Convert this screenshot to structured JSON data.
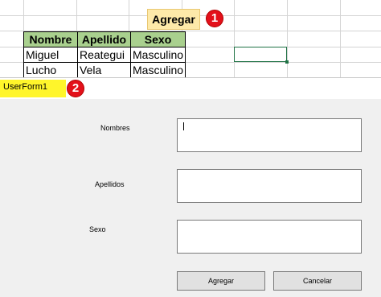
{
  "excel": {
    "headers": [
      "Nombre",
      "Apellido",
      "Sexo"
    ],
    "rows": [
      [
        "Miguel",
        "Reategui",
        "Masculino"
      ],
      [
        "Lucho",
        "Vela",
        "Masculino"
      ]
    ],
    "agregar_button": "Agregar",
    "header_fill": "#a9d08e"
  },
  "badges": {
    "one": "1",
    "two": "2"
  },
  "form": {
    "title": "UserForm1",
    "labels": {
      "nombres": "Nombres",
      "apellidos": "Apellidos",
      "sexo": "Sexo"
    },
    "fields": {
      "nombres": "",
      "apellidos": "",
      "sexo": ""
    },
    "buttons": {
      "agregar": "Agregar",
      "cancelar": "Cancelar"
    }
  },
  "colors": {
    "badge": "#e3101a",
    "highlight": "#fff52b",
    "form_bg": "#f0f0f0"
  }
}
